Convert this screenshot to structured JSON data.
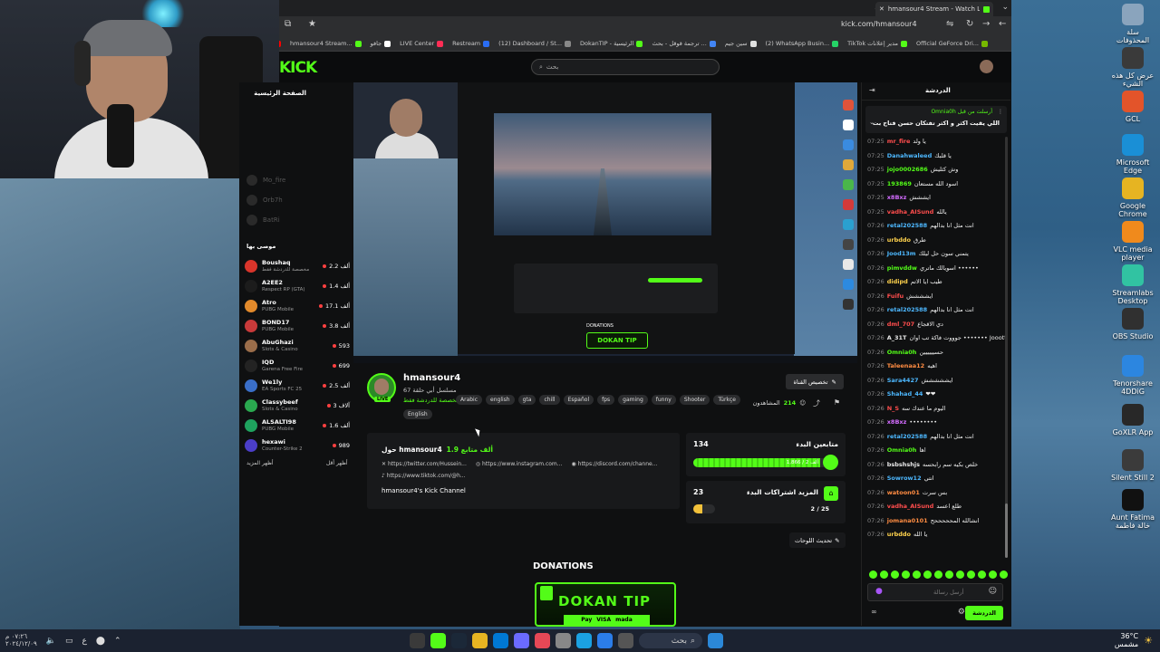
{
  "desktop": {
    "icons": [
      {
        "label": "سلة المحذوفات",
        "name": "recycle-bin-icon",
        "color": "#8aa4bd"
      },
      {
        "label": "عرض كل هذه الشيء",
        "name": "round-logo-icon",
        "color": "#3a3a3a"
      },
      {
        "label": "GCL",
        "name": "gcl-icon",
        "color": "#e3542a"
      },
      {
        "label": "Microsoft Edge",
        "name": "edge-icon",
        "color": "#1a8fd6"
      },
      {
        "label": "Google Chrome",
        "name": "chrome-icon",
        "color": "#e6b422"
      },
      {
        "label": "VLC media player",
        "name": "vlc-icon",
        "color": "#f08a1c"
      },
      {
        "label": "Streamlabs Desktop",
        "name": "streamlabs-icon",
        "color": "#31c3a2"
      },
      {
        "label": "OBS Studio",
        "name": "obs-icon",
        "color": "#303030"
      },
      {
        "label": "Tenorshare 4DDiG",
        "name": "tenorshare-icon",
        "color": "#2c86e0"
      },
      {
        "label": "GoXLR App",
        "name": "goxlr-icon",
        "color": "#282828"
      },
      {
        "label": "Silent Still 2",
        "name": "silent-still-icon",
        "color": "#3b3b3b"
      },
      {
        "label": "Aunt Fatima خالة فاطمة",
        "name": "aunt-fatima-icon",
        "color": "#111111"
      }
    ]
  },
  "taskbar": {
    "date": "٢٠٢٤/١٢/٠٩",
    "time": "٠٧:٢٦ م",
    "lang": "ع",
    "search_label": "بحث",
    "weather_temp": "36°C",
    "weather_desc": "مشمس"
  },
  "browser": {
    "tab_title": "hmansour4 Stream - Watch Live",
    "url": "kick.com/hmansour4",
    "bookmarks": [
      {
        "label": "YouTube",
        "color": "#ff0000"
      },
      {
        "label": "hmansour4 Stream...",
        "color": "#53fc18"
      },
      {
        "label": "جافو",
        "color": "#ffffff"
      },
      {
        "label": "LIVE Center",
        "color": "#ff2d55"
      },
      {
        "label": "Restream",
        "color": "#2a6df4"
      },
      {
        "label": "(12) Dashboard / St...",
        "color": "#888888"
      },
      {
        "label": "DokanTIP - الرئيسية",
        "color": "#53fc18"
      },
      {
        "label": "ترجمة قوقل - بحث ...",
        "color": "#4285f4"
      },
      {
        "label": "سين جيم",
        "color": "#e0e0e0"
      },
      {
        "label": "(2) WhatsApp Busin...",
        "color": "#25d366"
      },
      {
        "label": "TikTok مدير إعلانات",
        "color": "#53fc18"
      },
      {
        "label": "Official GeForce Dri...",
        "color": "#76b900"
      }
    ]
  },
  "kick": {
    "logo": "KICK",
    "search_placeholder": "بحث",
    "sidebar": {
      "title": "الصفحة الرئيسية",
      "ghost_items": [
        "Mo_fire",
        "Orb7h",
        "BatRi"
      ],
      "heading": "موصى بها",
      "items": [
        {
          "name": "Boushaq",
          "game": "مخصصة للدردشة فقط",
          "viewers": "2.2 ألف",
          "color": "#d9352b"
        },
        {
          "name": "A2EE2",
          "game": "Respect RP (GTA)",
          "viewers": "1.4 ألف",
          "color": "#1c1c1c"
        },
        {
          "name": "Atro",
          "game": "PUBG Mobile",
          "viewers": "17.1 ألف",
          "color": "#e28a2b"
        },
        {
          "name": "BOND17",
          "game": "PUBG Mobile",
          "viewers": "3.8 ألف",
          "color": "#c83a3a"
        },
        {
          "name": "AbuGhazi",
          "game": "Slots & Casino",
          "viewers": "593",
          "color": "#9a6d4a"
        },
        {
          "name": "IQD",
          "game": "Garena Free Fire",
          "viewers": "699",
          "color": "#232323"
        },
        {
          "name": "We1ly",
          "game": "EA Sports FC 25",
          "viewers": "2.5 ألف",
          "color": "#3a6ec8"
        },
        {
          "name": "Classybeef",
          "game": "Slots & Casino",
          "viewers": "3 آلاف",
          "color": "#2aa84f"
        },
        {
          "name": "ALSALTI98",
          "game": "PUBG Mobile",
          "viewers": "1.6 ألف",
          "color": "#1fa35e"
        },
        {
          "name": "hexawi",
          "game": "Counter-Strike 2",
          "viewers": "989",
          "color": "#4b3ec8"
        }
      ],
      "show_more": "أظهر المزيد",
      "show_less": "أظهر أقل"
    },
    "channel": {
      "name": "hmansour4",
      "live": "LIVE",
      "subtitle": "مسلسل أبي حلقة 67",
      "category": "مخصصة للدردشة فقط",
      "tags": [
        "Arabic",
        "english",
        "gta",
        "chill",
        "Español",
        "fps",
        "gaming",
        "funny",
        "Shooter",
        "Türkçe"
      ],
      "tag_extra": "English",
      "follow_label": "تخصيص القناة",
      "viewers_label": "المشاهدون",
      "viewers": "214"
    },
    "about": {
      "title": "حول hmansour4",
      "followers": "1.9 ألف متابع",
      "links": [
        "https://twitter.com/Hussein...",
        "https://www.instagram.com...",
        "https://discord.com/channe..."
      ],
      "tiktok": "https://www.tiktok.com/@h...",
      "description": "hmansour4's Kick Channel"
    },
    "goals": {
      "follow_title": "متابعين البدء",
      "follow_count": "134",
      "follow_progress_label": "1,866 / 2 ألف",
      "follow_progress": 0.93,
      "sub_title": "المزيد اشتراكات البدء",
      "sub_count": "23",
      "sub_progress_label": "2 / 25",
      "sub_progress": 0.08
    },
    "panels_button": "تحديث اللوحات",
    "donations_title": "DONATIONS",
    "dokan": {
      "title": "DOKAN TIP",
      "pay": [
        "Pay",
        "VISA",
        "mada"
      ]
    }
  },
  "chat": {
    "title": "الدردشة",
    "pinned_user": "Omnia0h أرسلت من قبل",
    "pinned_msg": "اللي يقيت اكثر و اكثر تفتكان حسن فتاح بت",
    "messages": [
      {
        "time": "07:25",
        "user": "mr_fire",
        "text": "يا ولد",
        "color": "#ff4d4d"
      },
      {
        "time": "07:25",
        "user": "Danahwaleed",
        "text": "يا قلبك",
        "color": "#4db8ff"
      },
      {
        "time": "07:25",
        "user": "jojo0002686",
        "text": "وش كثليش",
        "color": "#53fc18"
      },
      {
        "time": "07:25",
        "user": "193869",
        "text": "اسود الله مستعان",
        "color": "#53fc18"
      },
      {
        "time": "07:25",
        "user": "x8Bxz",
        "text": "ايششش",
        "color": "#d36cff"
      },
      {
        "time": "07:25",
        "user": "vadha_AISund",
        "text": "يالله",
        "color": "#ff4d4d"
      },
      {
        "time": "07:26",
        "user": "retal202588",
        "text": "انت مثل انا بدالهم",
        "color": "#4db8ff"
      },
      {
        "time": "07:26",
        "user": "urbddo",
        "text": "طرق",
        "color": "#ffd24d"
      },
      {
        "time": "07:26",
        "user": "Jood13m",
        "text": "يتمني سون حل ليلك",
        "color": "#4db8ff"
      },
      {
        "time": "07:26",
        "user": "pimvddw",
        "text": "اسويالك ماتري ••••••",
        "color": "#53fc18"
      },
      {
        "time": "07:26",
        "user": "didipd",
        "text": "طيب ايا الاتم",
        "color": "#ffd24d"
      },
      {
        "time": "07:26",
        "user": "Fuifu",
        "text": "ايشششش",
        "color": "#ff4d4d"
      },
      {
        "time": "07:26",
        "user": "retal202588",
        "text": "انت مثل انا بدالهم",
        "color": "#4db8ff"
      },
      {
        "time": "07:26",
        "user": "dml_707",
        "text": "دي الاقجاع",
        "color": "#ff4d4d"
      },
      {
        "time": "07:26",
        "user": "A_31T",
        "text": "جوووت فاكة تب اوان ••••••• Jooottv",
        "color": "#e8e8e8"
      },
      {
        "time": "07:26",
        "user": "Omnia0h",
        "text": "حسيييييين",
        "color": "#53fc18"
      },
      {
        "time": "07:26",
        "user": "Taleenaa12",
        "text": "اهيه",
        "color": "#ff8c42"
      },
      {
        "time": "07:26",
        "user": "Sara4427",
        "text": "ايششششش",
        "color": "#4db8ff"
      },
      {
        "time": "07:26",
        "user": "Shahad_44",
        "text": "❤❤",
        "color": "#4db8ff"
      },
      {
        "time": "07:26",
        "user": "N_S",
        "text": "اليوم ما عندك سه",
        "color": "#ff4d4d"
      },
      {
        "time": "07:26",
        "user": "x8Bxz",
        "text": "••••••••",
        "color": "#d36cff"
      },
      {
        "time": "07:26",
        "user": "retal202588",
        "text": "انت مثل انا بدالهم",
        "color": "#4db8ff"
      },
      {
        "time": "07:26",
        "user": "Omnia0h",
        "text": "اها",
        "color": "#53fc18"
      },
      {
        "time": "07:26",
        "user": "bsbshshjs",
        "text": "خلص بكيه سم رابحسه",
        "color": "#e8e8e8"
      },
      {
        "time": "07:26",
        "user": "Sowrow12",
        "text": "انتي",
        "color": "#4db8ff"
      },
      {
        "time": "07:26",
        "user": "watoon01",
        "text": "بس سرت",
        "color": "#ff8c42"
      },
      {
        "time": "07:26",
        "user": "vadha_AISund",
        "text": "طلع اعسد",
        "color": "#ff4d4d"
      },
      {
        "time": "07:26",
        "user": "jomana0101",
        "text": "انشالله المحححححح",
        "color": "#ff8c42"
      },
      {
        "time": "07:26",
        "user": "urbddo",
        "text": "يا الله",
        "color": "#ffd24d"
      }
    ],
    "input_placeholder": "أرسل رسالة",
    "send_label": "الدردشة"
  }
}
